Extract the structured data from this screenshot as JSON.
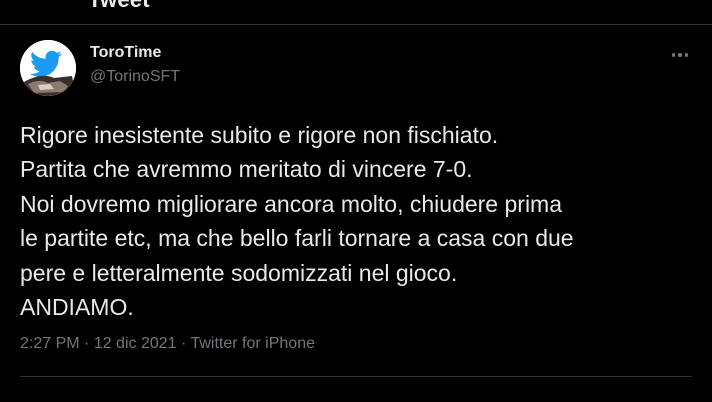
{
  "header": {
    "title": "Tweet"
  },
  "author": {
    "display_name": "ToroTime",
    "handle": "@TorinoSFT",
    "avatar_icon": "bird-logo-avatar",
    "brand_color": "#1d9bf0"
  },
  "more_icon": "more-horizontal-icon",
  "tweet": {
    "lines": [
      "Rigore inesistente subito e rigore non fischiato.",
      "Partita che avremmo meritato di vincere 7-0.",
      "Noi dovremo migliorare ancora molto, chiudere prima",
      "le partite etc, ma che bello farli tornare a casa con due",
      "pere e letteralmente sodomizzati nel gioco.",
      "ANDIAMO."
    ]
  },
  "meta": {
    "time": "2:27 PM",
    "separator": " · ",
    "date": "12 dic 2021",
    "source": "Twitter for iPhone"
  },
  "colors": {
    "background": "#000000",
    "text": "#e7e9ea",
    "secondary": "#71767b",
    "border": "#2f3336"
  }
}
